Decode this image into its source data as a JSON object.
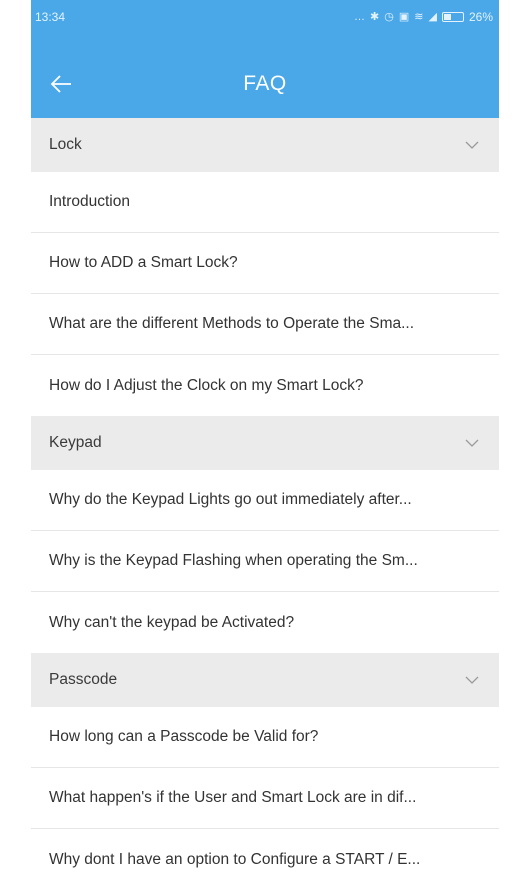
{
  "status_bar": {
    "time": "13:34",
    "battery": "26%"
  },
  "header": {
    "title": "FAQ"
  },
  "sections": [
    {
      "label": "Lock",
      "items": [
        "Introduction",
        "How to ADD a Smart Lock?",
        "What are the different Methods to Operate the Sma...",
        "How do I Adjust the Clock on my Smart Lock?"
      ]
    },
    {
      "label": "Keypad",
      "items": [
        "Why do the Keypad Lights go out immediately after...",
        "Why is the Keypad Flashing when operating the Sm...",
        "Why can't the keypad be Activated?"
      ]
    },
    {
      "label": "Passcode",
      "items": [
        "How long can a Passcode be Valid for?",
        "What happen's if the User and Smart Lock are in dif...",
        "Why dont I have an option to Configure a START / E..."
      ]
    }
  ],
  "colors": {
    "appbar": "#4aa8e8",
    "section_bg": "#ebebeb"
  }
}
